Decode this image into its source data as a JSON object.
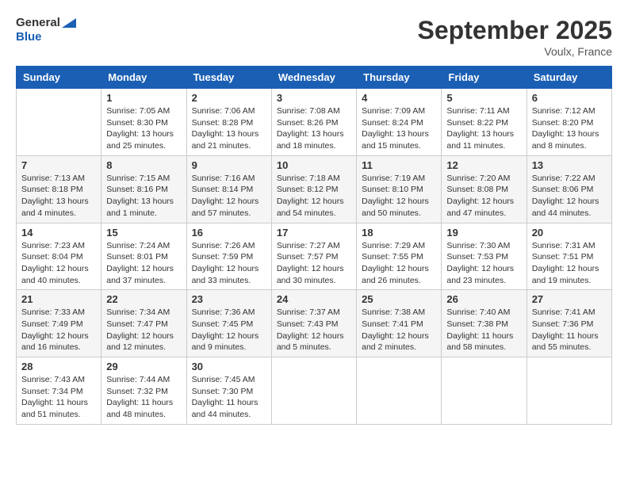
{
  "header": {
    "title": "September 2025",
    "location": "Voulx, France",
    "logo_line1": "General",
    "logo_line2": "Blue"
  },
  "days_of_week": [
    "Sunday",
    "Monday",
    "Tuesday",
    "Wednesday",
    "Thursday",
    "Friday",
    "Saturday"
  ],
  "weeks": [
    [
      {
        "day": "",
        "sunrise": "",
        "sunset": "",
        "daylight": ""
      },
      {
        "day": "1",
        "sunrise": "Sunrise: 7:05 AM",
        "sunset": "Sunset: 8:30 PM",
        "daylight": "Daylight: 13 hours and 25 minutes."
      },
      {
        "day": "2",
        "sunrise": "Sunrise: 7:06 AM",
        "sunset": "Sunset: 8:28 PM",
        "daylight": "Daylight: 13 hours and 21 minutes."
      },
      {
        "day": "3",
        "sunrise": "Sunrise: 7:08 AM",
        "sunset": "Sunset: 8:26 PM",
        "daylight": "Daylight: 13 hours and 18 minutes."
      },
      {
        "day": "4",
        "sunrise": "Sunrise: 7:09 AM",
        "sunset": "Sunset: 8:24 PM",
        "daylight": "Daylight: 13 hours and 15 minutes."
      },
      {
        "day": "5",
        "sunrise": "Sunrise: 7:11 AM",
        "sunset": "Sunset: 8:22 PM",
        "daylight": "Daylight: 13 hours and 11 minutes."
      },
      {
        "day": "6",
        "sunrise": "Sunrise: 7:12 AM",
        "sunset": "Sunset: 8:20 PM",
        "daylight": "Daylight: 13 hours and 8 minutes."
      }
    ],
    [
      {
        "day": "7",
        "sunrise": "Sunrise: 7:13 AM",
        "sunset": "Sunset: 8:18 PM",
        "daylight": "Daylight: 13 hours and 4 minutes."
      },
      {
        "day": "8",
        "sunrise": "Sunrise: 7:15 AM",
        "sunset": "Sunset: 8:16 PM",
        "daylight": "Daylight: 13 hours and 1 minute."
      },
      {
        "day": "9",
        "sunrise": "Sunrise: 7:16 AM",
        "sunset": "Sunset: 8:14 PM",
        "daylight": "Daylight: 12 hours and 57 minutes."
      },
      {
        "day": "10",
        "sunrise": "Sunrise: 7:18 AM",
        "sunset": "Sunset: 8:12 PM",
        "daylight": "Daylight: 12 hours and 54 minutes."
      },
      {
        "day": "11",
        "sunrise": "Sunrise: 7:19 AM",
        "sunset": "Sunset: 8:10 PM",
        "daylight": "Daylight: 12 hours and 50 minutes."
      },
      {
        "day": "12",
        "sunrise": "Sunrise: 7:20 AM",
        "sunset": "Sunset: 8:08 PM",
        "daylight": "Daylight: 12 hours and 47 minutes."
      },
      {
        "day": "13",
        "sunrise": "Sunrise: 7:22 AM",
        "sunset": "Sunset: 8:06 PM",
        "daylight": "Daylight: 12 hours and 44 minutes."
      }
    ],
    [
      {
        "day": "14",
        "sunrise": "Sunrise: 7:23 AM",
        "sunset": "Sunset: 8:04 PM",
        "daylight": "Daylight: 12 hours and 40 minutes."
      },
      {
        "day": "15",
        "sunrise": "Sunrise: 7:24 AM",
        "sunset": "Sunset: 8:01 PM",
        "daylight": "Daylight: 12 hours and 37 minutes."
      },
      {
        "day": "16",
        "sunrise": "Sunrise: 7:26 AM",
        "sunset": "Sunset: 7:59 PM",
        "daylight": "Daylight: 12 hours and 33 minutes."
      },
      {
        "day": "17",
        "sunrise": "Sunrise: 7:27 AM",
        "sunset": "Sunset: 7:57 PM",
        "daylight": "Daylight: 12 hours and 30 minutes."
      },
      {
        "day": "18",
        "sunrise": "Sunrise: 7:29 AM",
        "sunset": "Sunset: 7:55 PM",
        "daylight": "Daylight: 12 hours and 26 minutes."
      },
      {
        "day": "19",
        "sunrise": "Sunrise: 7:30 AM",
        "sunset": "Sunset: 7:53 PM",
        "daylight": "Daylight: 12 hours and 23 minutes."
      },
      {
        "day": "20",
        "sunrise": "Sunrise: 7:31 AM",
        "sunset": "Sunset: 7:51 PM",
        "daylight": "Daylight: 12 hours and 19 minutes."
      }
    ],
    [
      {
        "day": "21",
        "sunrise": "Sunrise: 7:33 AM",
        "sunset": "Sunset: 7:49 PM",
        "daylight": "Daylight: 12 hours and 16 minutes."
      },
      {
        "day": "22",
        "sunrise": "Sunrise: 7:34 AM",
        "sunset": "Sunset: 7:47 PM",
        "daylight": "Daylight: 12 hours and 12 minutes."
      },
      {
        "day": "23",
        "sunrise": "Sunrise: 7:36 AM",
        "sunset": "Sunset: 7:45 PM",
        "daylight": "Daylight: 12 hours and 9 minutes."
      },
      {
        "day": "24",
        "sunrise": "Sunrise: 7:37 AM",
        "sunset": "Sunset: 7:43 PM",
        "daylight": "Daylight: 12 hours and 5 minutes."
      },
      {
        "day": "25",
        "sunrise": "Sunrise: 7:38 AM",
        "sunset": "Sunset: 7:41 PM",
        "daylight": "Daylight: 12 hours and 2 minutes."
      },
      {
        "day": "26",
        "sunrise": "Sunrise: 7:40 AM",
        "sunset": "Sunset: 7:38 PM",
        "daylight": "Daylight: 11 hours and 58 minutes."
      },
      {
        "day": "27",
        "sunrise": "Sunrise: 7:41 AM",
        "sunset": "Sunset: 7:36 PM",
        "daylight": "Daylight: 11 hours and 55 minutes."
      }
    ],
    [
      {
        "day": "28",
        "sunrise": "Sunrise: 7:43 AM",
        "sunset": "Sunset: 7:34 PM",
        "daylight": "Daylight: 11 hours and 51 minutes."
      },
      {
        "day": "29",
        "sunrise": "Sunrise: 7:44 AM",
        "sunset": "Sunset: 7:32 PM",
        "daylight": "Daylight: 11 hours and 48 minutes."
      },
      {
        "day": "30",
        "sunrise": "Sunrise: 7:45 AM",
        "sunset": "Sunset: 7:30 PM",
        "daylight": "Daylight: 11 hours and 44 minutes."
      },
      {
        "day": "",
        "sunrise": "",
        "sunset": "",
        "daylight": ""
      },
      {
        "day": "",
        "sunrise": "",
        "sunset": "",
        "daylight": ""
      },
      {
        "day": "",
        "sunrise": "",
        "sunset": "",
        "daylight": ""
      },
      {
        "day": "",
        "sunrise": "",
        "sunset": "",
        "daylight": ""
      }
    ]
  ]
}
